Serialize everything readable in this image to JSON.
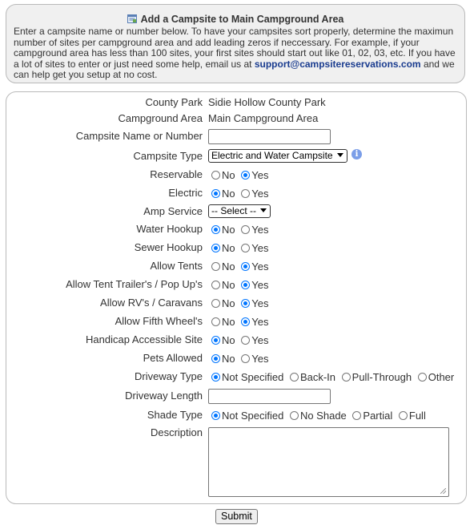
{
  "info": {
    "icon": "add-site-icon",
    "title": "Add a Campsite to Main Campground Area",
    "text_before_email": "Enter a campsite name or number below. To have your campsites sort properly, determine the maximun number of sites per campground area and add leading zeros if neccessary. For example, if your campground area has less than 100 sites, your first sites should start out like 01, 02, 03, etc. If you have a lot of sites to enter or just need some help, email us at ",
    "email": "support@campsitereservations.com",
    "text_after_email": " and we can help get you setup at no cost."
  },
  "form": {
    "county_park": {
      "label": "County Park",
      "value": "Sidie Hollow County Park"
    },
    "campground_area": {
      "label": "Campground Area",
      "value": "Main Campground Area"
    },
    "campsite_name": {
      "label": "Campsite Name or Number",
      "value": ""
    },
    "campsite_type": {
      "label": "Campsite Type",
      "selected": "Electric and Water Campsite",
      "info_icon": "info-icon"
    },
    "reservable": {
      "label": "Reservable",
      "options": [
        "No",
        "Yes"
      ],
      "selected": "Yes"
    },
    "electric": {
      "label": "Electric",
      "options": [
        "No",
        "Yes"
      ],
      "selected": "No"
    },
    "amp_service": {
      "label": "Amp Service",
      "selected": "-- Select --"
    },
    "water_hookup": {
      "label": "Water Hookup",
      "options": [
        "No",
        "Yes"
      ],
      "selected": "No"
    },
    "sewer_hookup": {
      "label": "Sewer Hookup",
      "options": [
        "No",
        "Yes"
      ],
      "selected": "No"
    },
    "allow_tents": {
      "label": "Allow Tents",
      "options": [
        "No",
        "Yes"
      ],
      "selected": "Yes"
    },
    "allow_tent_trailers": {
      "label": "Allow Tent Trailer's / Pop Up's",
      "options": [
        "No",
        "Yes"
      ],
      "selected": "Yes"
    },
    "allow_rvs": {
      "label": "Allow RV's / Caravans",
      "options": [
        "No",
        "Yes"
      ],
      "selected": "Yes"
    },
    "allow_fifth_wheels": {
      "label": "Allow Fifth Wheel's",
      "options": [
        "No",
        "Yes"
      ],
      "selected": "Yes"
    },
    "handicap_accessible": {
      "label": "Handicap Accessible Site",
      "options": [
        "No",
        "Yes"
      ],
      "selected": "No"
    },
    "pets_allowed": {
      "label": "Pets Allowed",
      "options": [
        "No",
        "Yes"
      ],
      "selected": "No"
    },
    "driveway_type": {
      "label": "Driveway Type",
      "options": [
        "Not Specified",
        "Back-In",
        "Pull-Through",
        "Other"
      ],
      "selected": "Not Specified"
    },
    "driveway_length": {
      "label": "Driveway Length",
      "value": ""
    },
    "shade_type": {
      "label": "Shade Type",
      "options": [
        "Not Specified",
        "No Shade",
        "Partial",
        "Full"
      ],
      "selected": "Not Specified"
    },
    "description": {
      "label": "Description",
      "value": ""
    }
  },
  "submit_label": "Submit"
}
